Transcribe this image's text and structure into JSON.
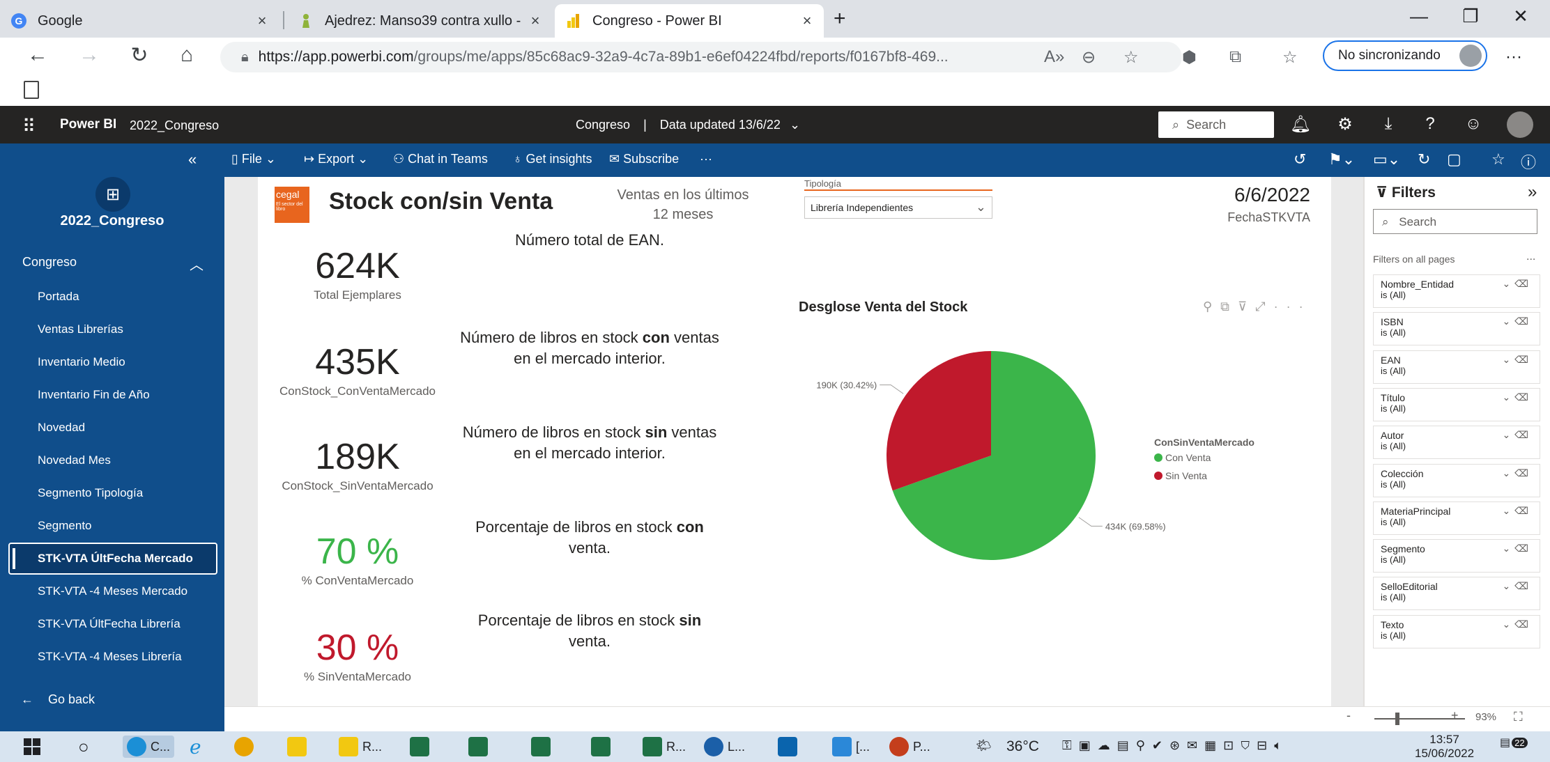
{
  "browser": {
    "tabs": [
      {
        "title": "Google",
        "close": "×"
      },
      {
        "title": "Ajedrez: Manso39 contra xullo -",
        "close": "×"
      },
      {
        "title": "Congreso - Power BI",
        "close": "×"
      }
    ],
    "new_tab": "+",
    "window_controls": {
      "minimize": "—",
      "restore": "❐",
      "close": "✕"
    },
    "url_host": "https://app.powerbi.com",
    "url_path": "/groups/me/apps/85c68ac9-32a9-4c7a-89b1-e6ef04224fbd/reports/f0167bf8-469...",
    "sync_label": "No sincronizando"
  },
  "pbi_header": {
    "product": "Power BI",
    "workspace": "2022_Congreso",
    "report": "Congreso",
    "separator": "|",
    "data_updated": "Data updated 13/6/22",
    "search_placeholder": "Search"
  },
  "toolbar": {
    "file": "File",
    "export": "Export",
    "chat_in_teams": "Chat in Teams",
    "get_insights": "Get insights",
    "subscribe": "Subscribe",
    "more": "···"
  },
  "nav": {
    "app_name": "2022_Congreso",
    "section": "Congreso",
    "items": [
      {
        "label": "Portada"
      },
      {
        "label": "Ventas Librerías"
      },
      {
        "label": "Inventario Medio"
      },
      {
        "label": "Inventario Fin de Año"
      },
      {
        "label": "Novedad"
      },
      {
        "label": "Novedad Mes"
      },
      {
        "label": "Segmento Tipología"
      },
      {
        "label": "Segmento"
      },
      {
        "label": "STK-VTA ÚltFecha Mercado",
        "selected": true
      },
      {
        "label": "STK-VTA -4 Meses Mercado"
      },
      {
        "label": "STK-VTA ÚltFecha Librería"
      },
      {
        "label": "STK-VTA -4 Meses Librería"
      }
    ],
    "go_back": "Go back"
  },
  "report": {
    "logo_text": "cegal",
    "logo_sub": "El sector del libro",
    "title": "Stock con/sin Venta",
    "subtitle_line1": "Ventas en los últimos",
    "subtitle_line2": "12 meses",
    "tipologia_label": "Tipología",
    "tipologia_value": "Librería Independientes",
    "date": "6/6/2022",
    "date_label": "FechaSTKVTA",
    "kpis": [
      {
        "value": "624K",
        "label": "Total Ejemplares",
        "color": "#252423"
      },
      {
        "value": "435K",
        "label": "ConStock_ConVentaMercado",
        "color": "#252423"
      },
      {
        "value": "189K",
        "label": "ConStock_SinVentaMercado",
        "color": "#252423"
      },
      {
        "value": "70 %",
        "label": "% ConVentaMercado",
        "color": "#3bb54a"
      },
      {
        "value": "30 %",
        "label": "% SinVentaMercado",
        "color": "#c0192c"
      }
    ],
    "descriptions": {
      "d1": "Número total de EAN.",
      "d2_pre": "Número de libros en stock ",
      "d2_bold": "con",
      "d2_post": " ventas en el mercado interior.",
      "d3_pre": "Número de libros en stock ",
      "d3_bold": "sin",
      "d3_post": " ventas en el mercado interior.",
      "d4_pre": "Porcentaje de libros en stock ",
      "d4_bold": "con",
      "d4_post": " venta.",
      "d5_pre": "Porcentaje de libros en stock ",
      "d5_bold": "sin",
      "d5_post": " venta."
    }
  },
  "chart_data": {
    "type": "pie",
    "title": "Desglose Venta del Stock",
    "legend_title": "ConSinVentaMercado",
    "legend_position": "right",
    "slices": [
      {
        "name": "Con Venta",
        "value": 434,
        "label": "434K (69.58%)",
        "color": "#3bb54a"
      },
      {
        "name": "Sin Venta",
        "value": 190,
        "label": "190K (30.42%)",
        "color": "#c0192c"
      }
    ]
  },
  "filters": {
    "title": "Filters",
    "search_placeholder": "Search",
    "section": "Filters on all pages",
    "more": "...",
    "cards": [
      {
        "name": "Nombre_Entidad",
        "value": "is (All)"
      },
      {
        "name": "ISBN",
        "value": "is (All)"
      },
      {
        "name": "EAN",
        "value": "is (All)"
      },
      {
        "name": "Título",
        "value": "is (All)"
      },
      {
        "name": "Autor",
        "value": "is (All)"
      },
      {
        "name": "Colección",
        "value": "is (All)"
      },
      {
        "name": "MateriaPrincipal",
        "value": "is (All)"
      },
      {
        "name": "Segmento",
        "value": "is (All)"
      },
      {
        "name": "SelloEditorial",
        "value": "is (All)"
      },
      {
        "name": "Texto",
        "value": "is (All)"
      }
    ]
  },
  "status": {
    "zoom_minus": "-",
    "zoom_plus": "+",
    "zoom": "93%"
  },
  "taskbar": {
    "apps": [
      "C...",
      "R...",
      "R...",
      "L...",
      "[...",
      "P..."
    ],
    "temperature": "36°C",
    "time": "13:57",
    "date": "15/06/2022",
    "notifications": "22"
  }
}
